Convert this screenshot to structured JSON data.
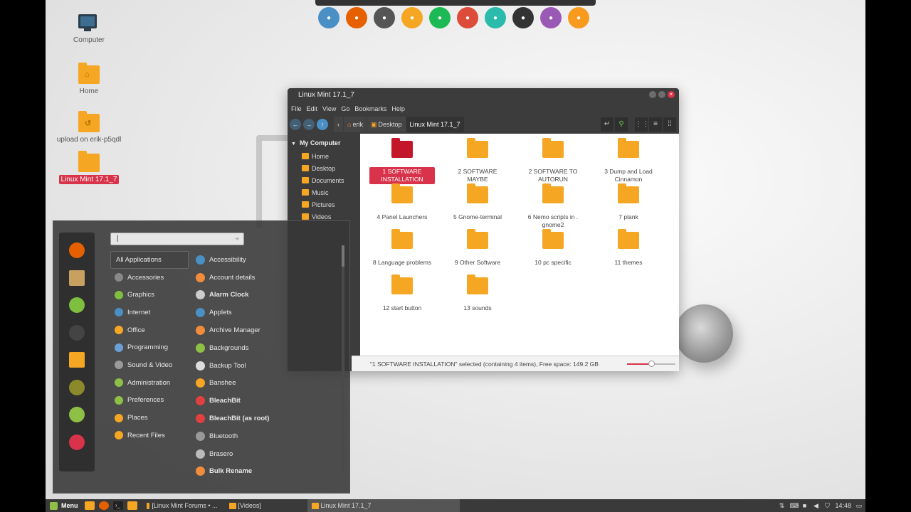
{
  "desktop": {
    "icons": [
      {
        "label": "Computer",
        "type": "computer"
      },
      {
        "label": "Home",
        "type": "home"
      },
      {
        "label": "upload on erik-p5qdl",
        "type": "upload"
      },
      {
        "label": "Linux Mint 17.1_7",
        "type": "folder",
        "selected": true
      }
    ]
  },
  "dock": {
    "items": [
      {
        "icon": "anchor-icon",
        "color": "#4a90c4"
      },
      {
        "icon": "firefox-icon",
        "color": "#e66000"
      },
      {
        "icon": "record-icon",
        "color": "#555555"
      },
      {
        "icon": "folder-icon",
        "color": "#f5a623"
      },
      {
        "icon": "spotify-icon",
        "color": "#1db954"
      },
      {
        "icon": "chrome-icon",
        "color": "#dd4b39"
      },
      {
        "icon": "system-monitor-icon",
        "color": "#2bbbad"
      },
      {
        "icon": "terminal-icon",
        "color": "#333333"
      },
      {
        "icon": "webcam-icon",
        "color": "#9b59b6"
      },
      {
        "icon": "sublime-icon",
        "color": "#f79a1e"
      }
    ]
  },
  "window": {
    "title": "Linux Mint 17.1_7",
    "menu": [
      "File",
      "Edit",
      "View",
      "Go",
      "Bookmarks",
      "Help"
    ],
    "breadcrumbs": [
      "erik",
      "Desktop",
      "Linux Mint 17.1_7"
    ],
    "sidebar": {
      "heading": "My Computer",
      "items": [
        "Home",
        "Desktop",
        "Documents",
        "Music",
        "Pictures",
        "Videos"
      ]
    },
    "files": [
      {
        "name": "1 SOFTWARE INSTALLATION",
        "selected": true
      },
      {
        "name": "2 SOFTWARE MAYBE"
      },
      {
        "name": "2 SOFTWARE TO AUTORUN"
      },
      {
        "name": "3 Dump and Load Cinnamon"
      },
      {
        "name": "4 Panel Launchers"
      },
      {
        "name": "5 Gnome-terminal"
      },
      {
        "name": "6 Nemo scripts in . gnome2"
      },
      {
        "name": "7 plank"
      },
      {
        "name": "8 Language problems"
      },
      {
        "name": "9 Other Software"
      },
      {
        "name": "10 pc specific"
      },
      {
        "name": "11 themes"
      },
      {
        "name": "12 start button"
      },
      {
        "name": "13 sounds"
      }
    ],
    "status": "\"1 SOFTWARE INSTALLATION\" selected (containing 4 items), Free space: 149.2 GB",
    "zoom_level": 0.5
  },
  "start_menu": {
    "search_value": "|",
    "favorites": [
      {
        "icon": "firefox-icon",
        "color": "#e66000"
      },
      {
        "icon": "package-icon",
        "color": "#c8a060"
      },
      {
        "icon": "software-manager-icon",
        "color": "#7fbf3f"
      },
      {
        "icon": "terminal-icon",
        "color": "#444444"
      },
      {
        "icon": "files-icon",
        "color": "#f5a623"
      },
      {
        "icon": "screen-lock-icon",
        "color": "#8a8a2a"
      },
      {
        "icon": "logout-icon",
        "color": "#8fc046"
      },
      {
        "icon": "power-icon",
        "color": "#d8334a"
      }
    ],
    "categories": [
      {
        "label": "All Applications",
        "color": ""
      },
      {
        "label": "Accessories",
        "color": "#888888"
      },
      {
        "label": "Graphics",
        "color": "#7fbf3f"
      },
      {
        "label": "Internet",
        "color": "#4a90c4"
      },
      {
        "label": "Office",
        "color": "#f5a623"
      },
      {
        "label": "Programming",
        "color": "#6aa0d8"
      },
      {
        "label": "Sound & Video",
        "color": "#9a9a9a"
      },
      {
        "label": "Administration",
        "color": "#8fc046"
      },
      {
        "label": "Preferences",
        "color": "#8fc046"
      },
      {
        "label": "Places",
        "color": "#f5a623"
      },
      {
        "label": "Recent Files",
        "color": "#f5a623"
      }
    ],
    "apps": [
      {
        "label": "Accessibility",
        "color": "#4a90c4",
        "bold": false
      },
      {
        "label": "Account details",
        "color": "#f08c3c",
        "bold": false
      },
      {
        "label": "Alarm Clock",
        "color": "#cccccc",
        "bold": true
      },
      {
        "label": "Applets",
        "color": "#4a90c4",
        "bold": false
      },
      {
        "label": "Archive Manager",
        "color": "#f08c3c",
        "bold": false
      },
      {
        "label": "Backgrounds",
        "color": "#8fc046",
        "bold": false
      },
      {
        "label": "Backup Tool",
        "color": "#dddddd",
        "bold": false
      },
      {
        "label": "Banshee",
        "color": "#f5a623",
        "bold": false
      },
      {
        "label": "BleachBit",
        "color": "#e04040",
        "bold": true
      },
      {
        "label": "BleachBit (as root)",
        "color": "#e04040",
        "bold": true
      },
      {
        "label": "Bluetooth",
        "color": "#999999",
        "bold": false
      },
      {
        "label": "Brasero",
        "color": "#bbbbbb",
        "bold": false
      },
      {
        "label": "Bulk Rename",
        "color": "#f08c3c",
        "bold": true
      }
    ]
  },
  "taskbar": {
    "menu_label": "Menu",
    "tasks": [
      {
        "label": "[Linux Mint Forums • ...",
        "active": false
      },
      {
        "label": "[Videos]",
        "active": false
      },
      {
        "label": "Linux Mint 17.1_7",
        "active": true
      }
    ],
    "clock": "14:48"
  }
}
